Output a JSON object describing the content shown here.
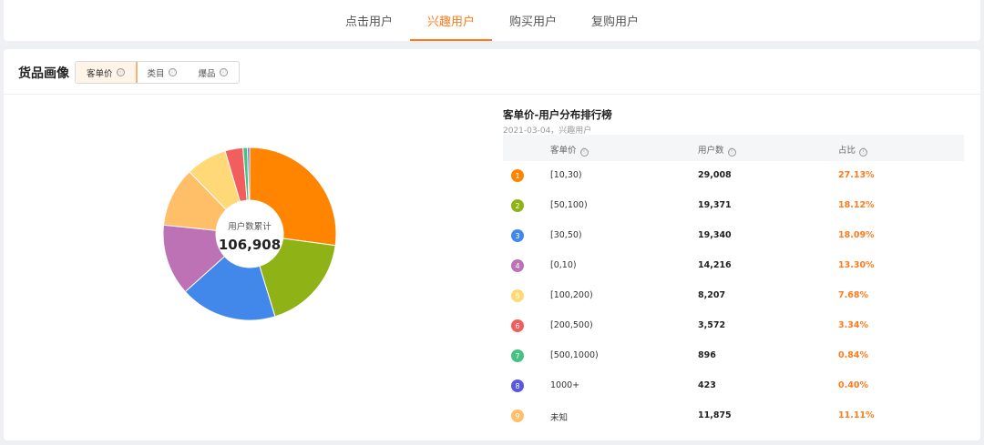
{
  "tabs": [
    {
      "label": "点击用户",
      "active": false
    },
    {
      "label": "兴趣用户",
      "active": true
    },
    {
      "label": "购买用户",
      "active": false
    },
    {
      "label": "复购用户",
      "active": false
    }
  ],
  "card": {
    "title": "货品画像",
    "segments": [
      {
        "label": "客单价",
        "active": true
      },
      {
        "label": "类目",
        "active": false
      },
      {
        "label": "爆品",
        "active": false
      }
    ],
    "info_glyph": "ⓘ"
  },
  "donut": {
    "center_label": "用户数累计",
    "center_value": "106,908"
  },
  "ranking": {
    "title": "客单价-用户分布排行榜",
    "subtitle": "2021-03-04，兴趣用户",
    "headers": [
      "客单价",
      "用户数",
      "占比"
    ],
    "rows": [
      {
        "rank": "1",
        "range": "[10,30)",
        "users": "29,008",
        "share": "27.13%",
        "color": "#ff8400"
      },
      {
        "rank": "2",
        "range": "[50,100)",
        "users": "19,371",
        "share": "18.12%",
        "color": "#8fb316"
      },
      {
        "rank": "3",
        "range": "[30,50)",
        "users": "19,340",
        "share": "18.09%",
        "color": "#4288ea"
      },
      {
        "rank": "4",
        "range": "[0,10)",
        "users": "14,216",
        "share": "13.30%",
        "color": "#bd72b5"
      },
      {
        "rank": "5",
        "range": "[100,200)",
        "users": "8,207",
        "share": "7.68%",
        "color": "#ffd978"
      },
      {
        "rank": "6",
        "range": "[200,500)",
        "users": "3,572",
        "share": "3.34%",
        "color": "#f25d5d"
      },
      {
        "rank": "7",
        "range": "[500,1000)",
        "users": "896",
        "share": "0.84%",
        "color": "#45c27f"
      },
      {
        "rank": "8",
        "range": "1000+",
        "users": "423",
        "share": "0.40%",
        "color": "#5759e0"
      },
      {
        "rank": "9",
        "range": "未知",
        "users": "11,875",
        "share": "11.11%",
        "color": "#ffbe68"
      }
    ]
  },
  "chart_data": {
    "type": "pie",
    "donut": true,
    "categories": [
      "[10,30)",
      "[50,100)",
      "[30,50)",
      "[0,10)",
      "未知",
      "[100,200)",
      "[200,500)",
      "[500,1000)",
      "1000+"
    ],
    "values": [
      29008,
      19371,
      19340,
      14216,
      11875,
      8207,
      3572,
      896,
      423
    ],
    "colors": [
      "#ff8400",
      "#8fb316",
      "#4288ea",
      "#bd72b5",
      "#ffbe68",
      "#ffd978",
      "#f25d5d",
      "#45c27f",
      "#5759e0"
    ]
  }
}
